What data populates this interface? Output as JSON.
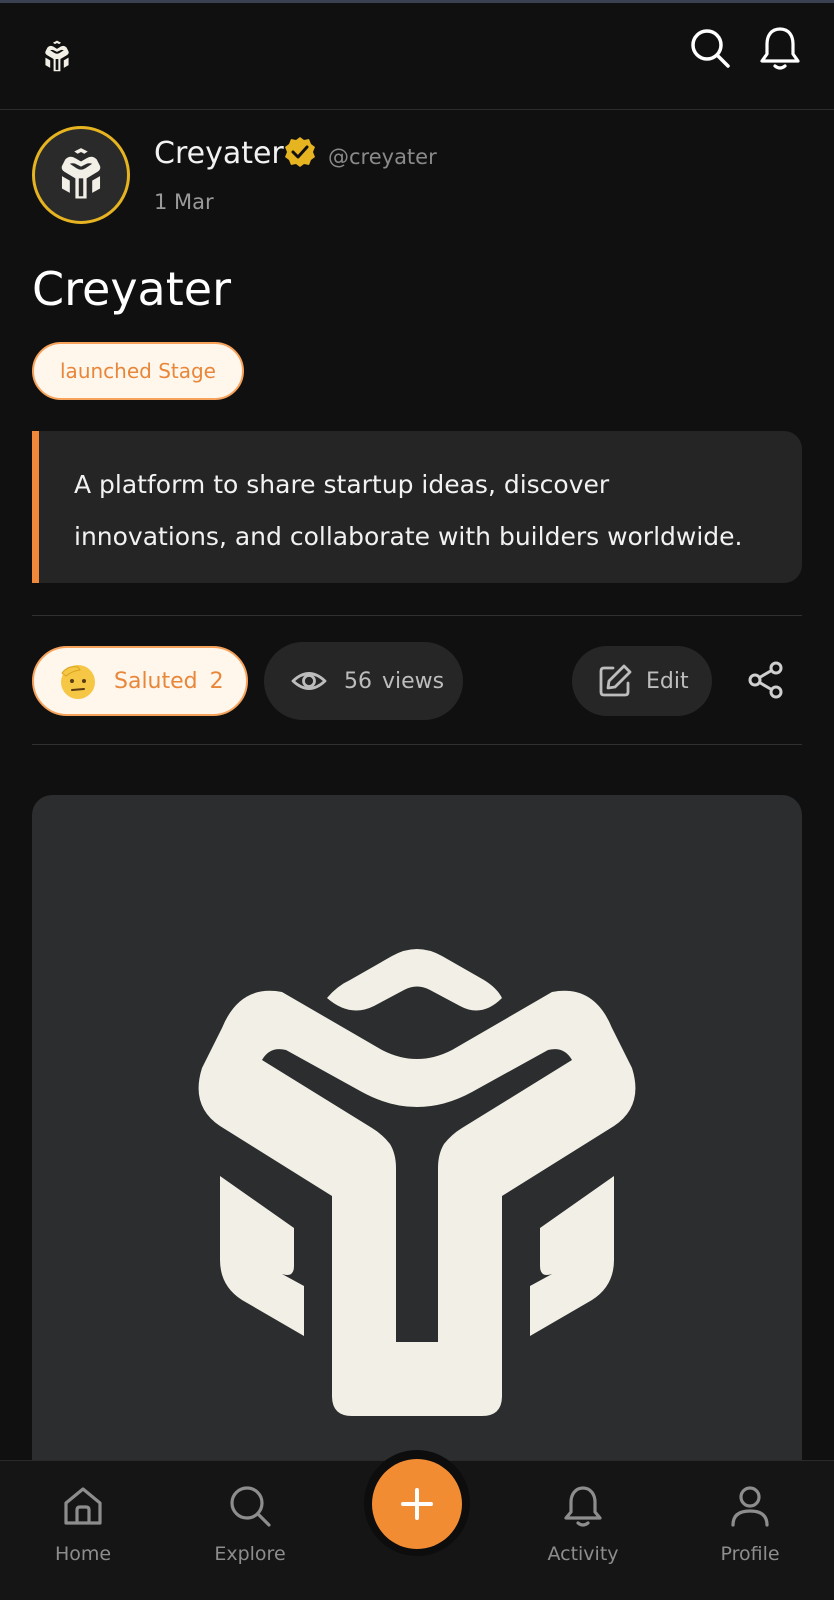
{
  "topbar": {
    "logo_icon": "creyater-logo-icon",
    "search_icon": "search-icon",
    "notifications_icon": "bell-icon"
  },
  "post": {
    "author_name": "Creyater",
    "verified_icon": "verified-badge-icon",
    "handle": "@creyater",
    "date": "1 Mar",
    "title": "Creyater",
    "stage": "launched Stage",
    "description": "A platform to share startup ideas, discover innovations, and collaborate with builders worldwide."
  },
  "actions": {
    "salute_label": "Saluted",
    "salute_count": "2",
    "views_count": "56",
    "views_label": "views",
    "edit_label": "Edit"
  },
  "nav": {
    "home": "Home",
    "explore": "Explore",
    "activity": "Activity",
    "profile": "Profile"
  },
  "colors": {
    "accent": "#f28c33",
    "badge_bg": "#fff6ec",
    "verified": "#e6b321",
    "background": "#101010",
    "card": "#252525"
  }
}
